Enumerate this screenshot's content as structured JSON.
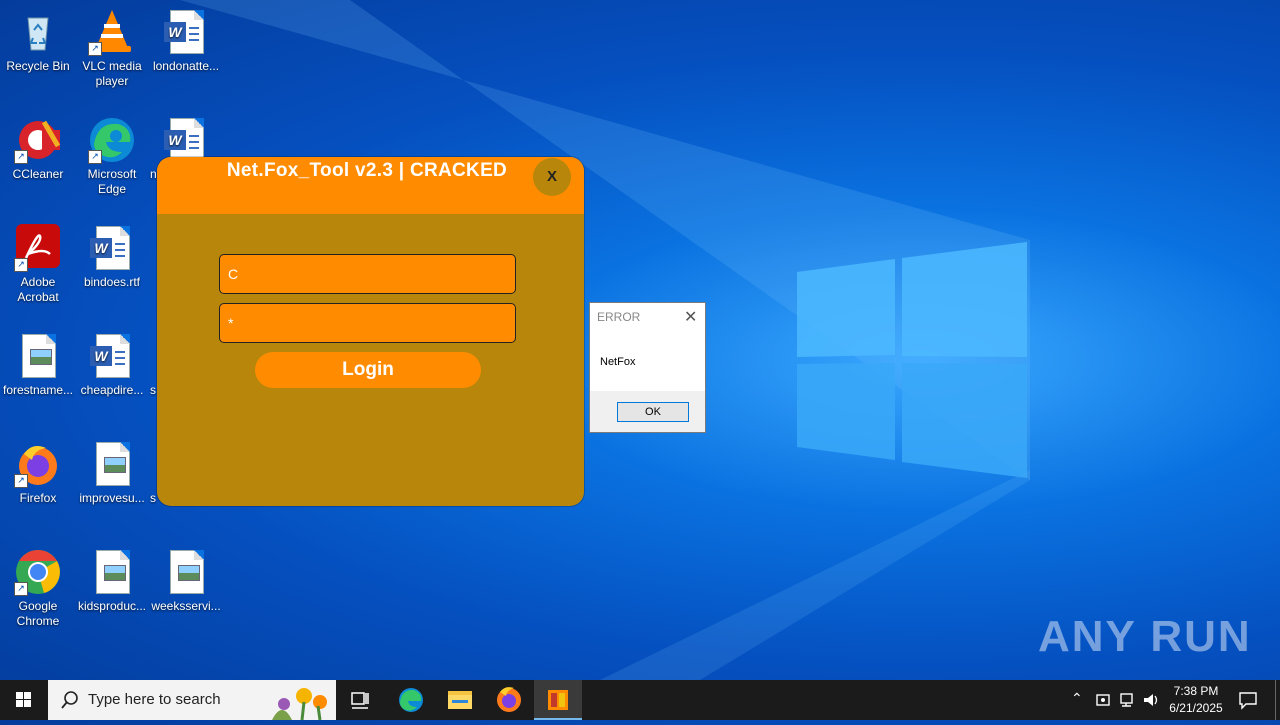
{
  "desktop": {
    "icons": [
      {
        "label": "Recycle Bin"
      },
      {
        "label": "VLC media player"
      },
      {
        "label": "londonatte..."
      },
      {
        "label": "CCleaner"
      },
      {
        "label": "Microsoft Edge"
      },
      {
        "label": "n"
      },
      {
        "label": "Adobe Acrobat"
      },
      {
        "label": "bindoes.rtf"
      },
      {
        "label": "forestname..."
      },
      {
        "label": "cheapdire..."
      },
      {
        "label": "s"
      },
      {
        "label": "Firefox"
      },
      {
        "label": "improvesu..."
      },
      {
        "label": "s"
      },
      {
        "label": "Google Chrome"
      },
      {
        "label": "kidsproduc..."
      },
      {
        "label": "weeksservi..."
      }
    ]
  },
  "app": {
    "title": "Net.Fox_Tool v2.3  |  CRACKED",
    "close_label": "X",
    "username_value": "C",
    "password_value": "*",
    "login_label": "Login"
  },
  "error_dialog": {
    "title": "ERROR",
    "close_glyph": "✕",
    "message": "NetFox",
    "ok_label": "OK"
  },
  "watermark": "ANY RUN",
  "taskbar": {
    "search_placeholder": "Type here to search",
    "time": "7:38 PM",
    "date": "6/21/2025"
  },
  "colors": {
    "app_header": "#ff8c00",
    "app_body": "#b8860b",
    "taskbar": "#1b1b1b"
  }
}
